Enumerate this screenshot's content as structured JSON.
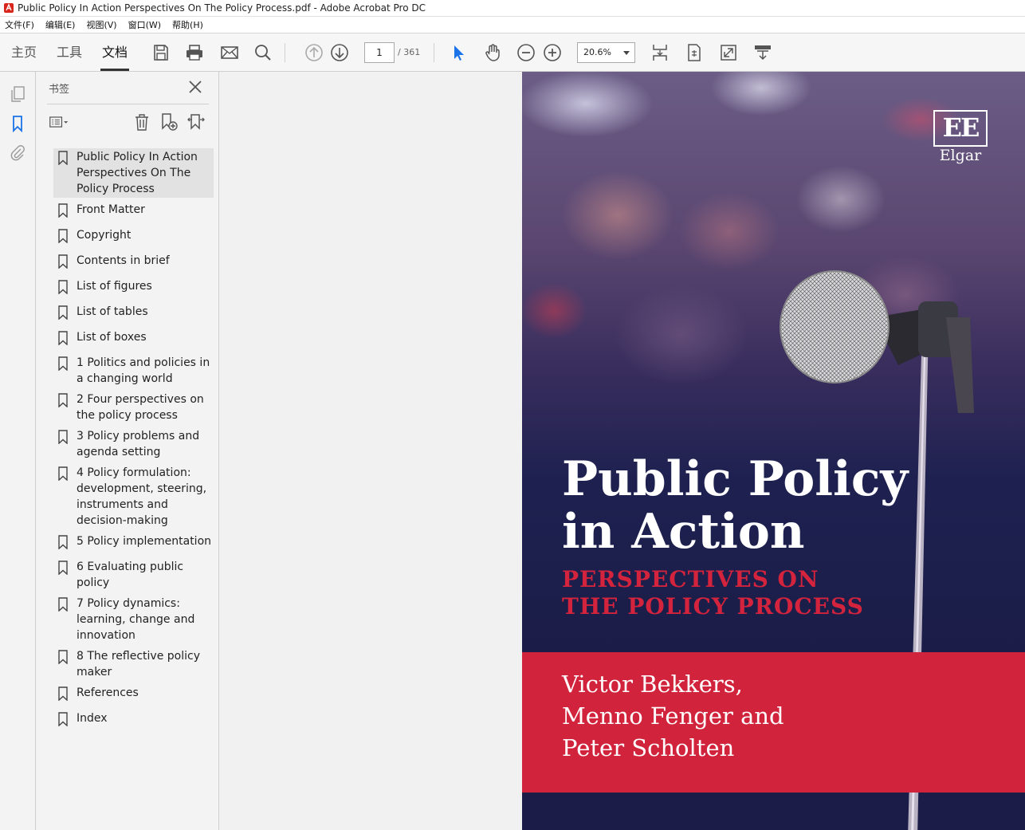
{
  "window": {
    "title": "Public Policy In Action Perspectives On The Policy Process.pdf - Adobe Acrobat Pro DC"
  },
  "menu": [
    "文件(F)",
    "编辑(E)",
    "视图(V)",
    "窗口(W)",
    "帮助(H)"
  ],
  "tabs": [
    {
      "label": "主页",
      "active": false
    },
    {
      "label": "工具",
      "active": false
    },
    {
      "label": "文档",
      "active": true
    }
  ],
  "toolbar": {
    "icons": [
      "save-icon",
      "print-icon",
      "email-icon",
      "search-icon",
      "page-up-icon",
      "page-down-icon",
      "select-cursor-icon",
      "hand-icon",
      "zoom-out-icon",
      "zoom-in-icon",
      "fit-page-icon",
      "rotate-icon",
      "fullscreen-icon",
      "read-mode-icon"
    ],
    "page_current": "1",
    "page_total": "/ 361",
    "zoom": "20.6%",
    "accent_color": "#1a73e8"
  },
  "side_panel": {
    "title": "书签",
    "icons": [
      "pages-icon",
      "bookmark-icon",
      "attachment-icon"
    ]
  },
  "bookmarks": [
    {
      "label": "Public Policy In Action Perspectives On The Policy Process",
      "selected": true
    },
    {
      "label": "Front Matter"
    },
    {
      "label": "Copyright"
    },
    {
      "label": "Contents in brief"
    },
    {
      "label": "List of figures"
    },
    {
      "label": "List of tables"
    },
    {
      "label": "List of boxes"
    },
    {
      "label": "1 Politics and policies in a changing world"
    },
    {
      "label": "2 Four perspectives on the policy process"
    },
    {
      "label": "3 Policy problems and agenda setting"
    },
    {
      "label": "4 Policy formulation: development, steering, instruments and decision-making"
    },
    {
      "label": "5 Policy implementation"
    },
    {
      "label": "6 Evaluating public policy"
    },
    {
      "label": "7 Policy dynamics: learning, change and innovation"
    },
    {
      "label": "8 The reflective policy maker"
    },
    {
      "label": "References"
    },
    {
      "label": "Index"
    }
  ],
  "cover": {
    "logo": "EE",
    "logo_sub": "Elgar",
    "title_line1": "Public Policy",
    "title_line2": "in Action",
    "subtitle_line1": "PERSPECTIVES ON",
    "subtitle_line2": "THE POLICY PROCESS",
    "author_line1": "Victor Bekkers,",
    "author_line2": "Menno Fenger and",
    "author_line3": "Peter Scholten",
    "band_color": "#d1243c",
    "navy_color": "#1b1d48"
  }
}
